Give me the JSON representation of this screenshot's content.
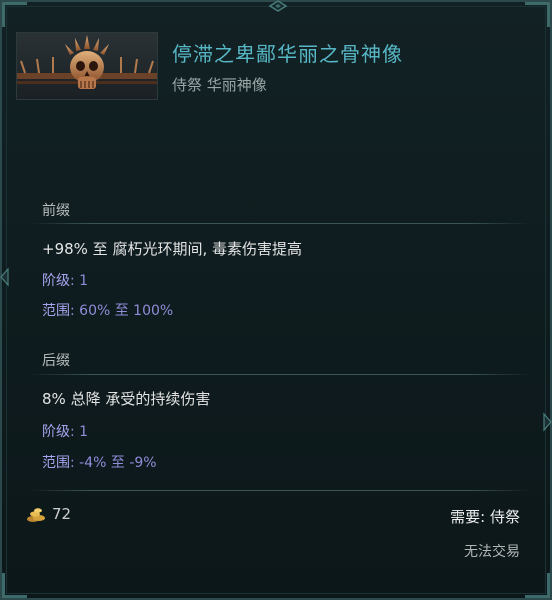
{
  "item": {
    "name": "停滞之卑鄙华丽之骨神像",
    "type_line": "侍祭 华丽神像"
  },
  "prefix": {
    "heading": "前缀",
    "effect": "+98% 至 腐朽光环期间, 毒素伤害提高",
    "tier_label": "阶级",
    "tier_value": ": 1",
    "range_label": "范围",
    "range_value": ": 60% 至 100%"
  },
  "suffix": {
    "heading": "后缀",
    "effect": "8% 总降 承受的持续伤害",
    "tier_label": "阶级",
    "tier_value": ": 1",
    "range_label": "范围",
    "range_value": ": -4% 至 -9%"
  },
  "footer": {
    "cost_icon": "gold-pile-icon",
    "cost_value": "72",
    "requirement": "需要: 侍祭",
    "trade_status": "无法交易"
  },
  "colors": {
    "title": "#57b7c6",
    "affix_meta": "#8f8cd8",
    "frame": "#2c4a4c",
    "background": "#0f1d20"
  }
}
